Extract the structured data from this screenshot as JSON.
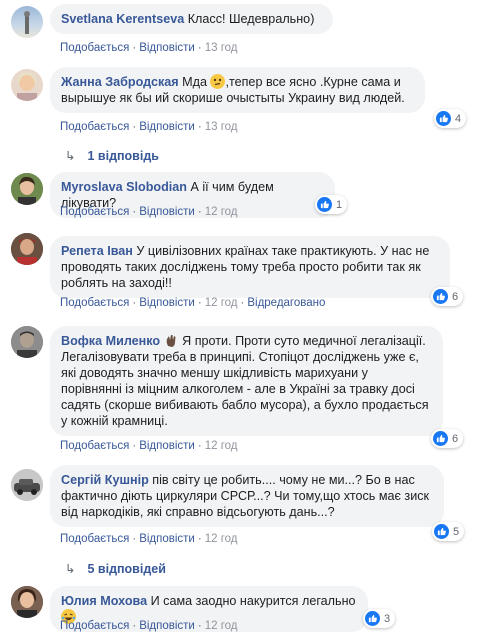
{
  "comments": [
    {
      "author": "Svetlana Kerentseva",
      "text": "Класс! Шедеврально)",
      "actions": {
        "like": "Подобається",
        "reply": "Відповісти",
        "time": "13 год"
      }
    },
    {
      "author": "Жанна Забродская",
      "text_before": "Мда",
      "text_after": ",тепер все ясно .Курне сама и вырышуе як бы ий скорише очыстыты Украину вид людей.",
      "reactions": "4",
      "actions": {
        "like": "Подобається",
        "reply": "Відповісти",
        "time": "13 год"
      },
      "replies": "1 відповідь"
    },
    {
      "author": "Myroslava Slobodian",
      "text": "А ії чим будем лікувати?",
      "reactions": "1",
      "actions": {
        "like": "Подобається",
        "reply": "Відповісти",
        "time": "12 год"
      }
    },
    {
      "author": "Репета Іван",
      "text": "У цивілізовних країнах таке практикують. У нас не проводять таких досліджень тому треба просто робити так як роблять на заході!!",
      "reactions": "6",
      "actions": {
        "like": "Подобається",
        "reply": "Відповісти",
        "time": "12 год",
        "edited": "Відредаговано"
      }
    },
    {
      "author": "Вофка Миленко",
      "text": "Я проти. Проти суто медичної легалізації. Легалізовувати треба в принципі. Стопіцот досліджень уже є, які доводять значно меншу шкідливість марихуани у порівнянні із міцним алкоголем - але в Україні за травку досі садять (скорше вибивають бабло мусора), а бухло продається у кожній крамниці.",
      "reactions": "6",
      "actions": {
        "like": "Подобається",
        "reply": "Відповісти",
        "time": "12 год"
      }
    },
    {
      "author": "Сергій Кушнір",
      "text": "пів світу це робить.... чому не ми...? Бо в нас фактично діють циркуляри СРСР...? Чи тому,що хтось має зиск від наркодіків, які справно відсьогують дань...?",
      "reactions": "5",
      "actions": {
        "like": "Подобається",
        "reply": "Відповісти",
        "time": "12 год"
      },
      "replies": "5 відповідей"
    },
    {
      "author": "Юлия Мохова",
      "text": "И сама заодно накурится легально",
      "reactions": "3",
      "actions": {
        "like": "Подобається",
        "reply": "Відповісти",
        "time": "12 год"
      }
    }
  ],
  "colors": {
    "link": "#385898",
    "bubble": "#f2f3f5",
    "like": "#1877f2"
  },
  "icons": [
    "like-icon",
    "thinking-emoji-icon",
    "waving-hand-icon",
    "laughing-emoji-icon",
    "reply-arrow-icon"
  ]
}
